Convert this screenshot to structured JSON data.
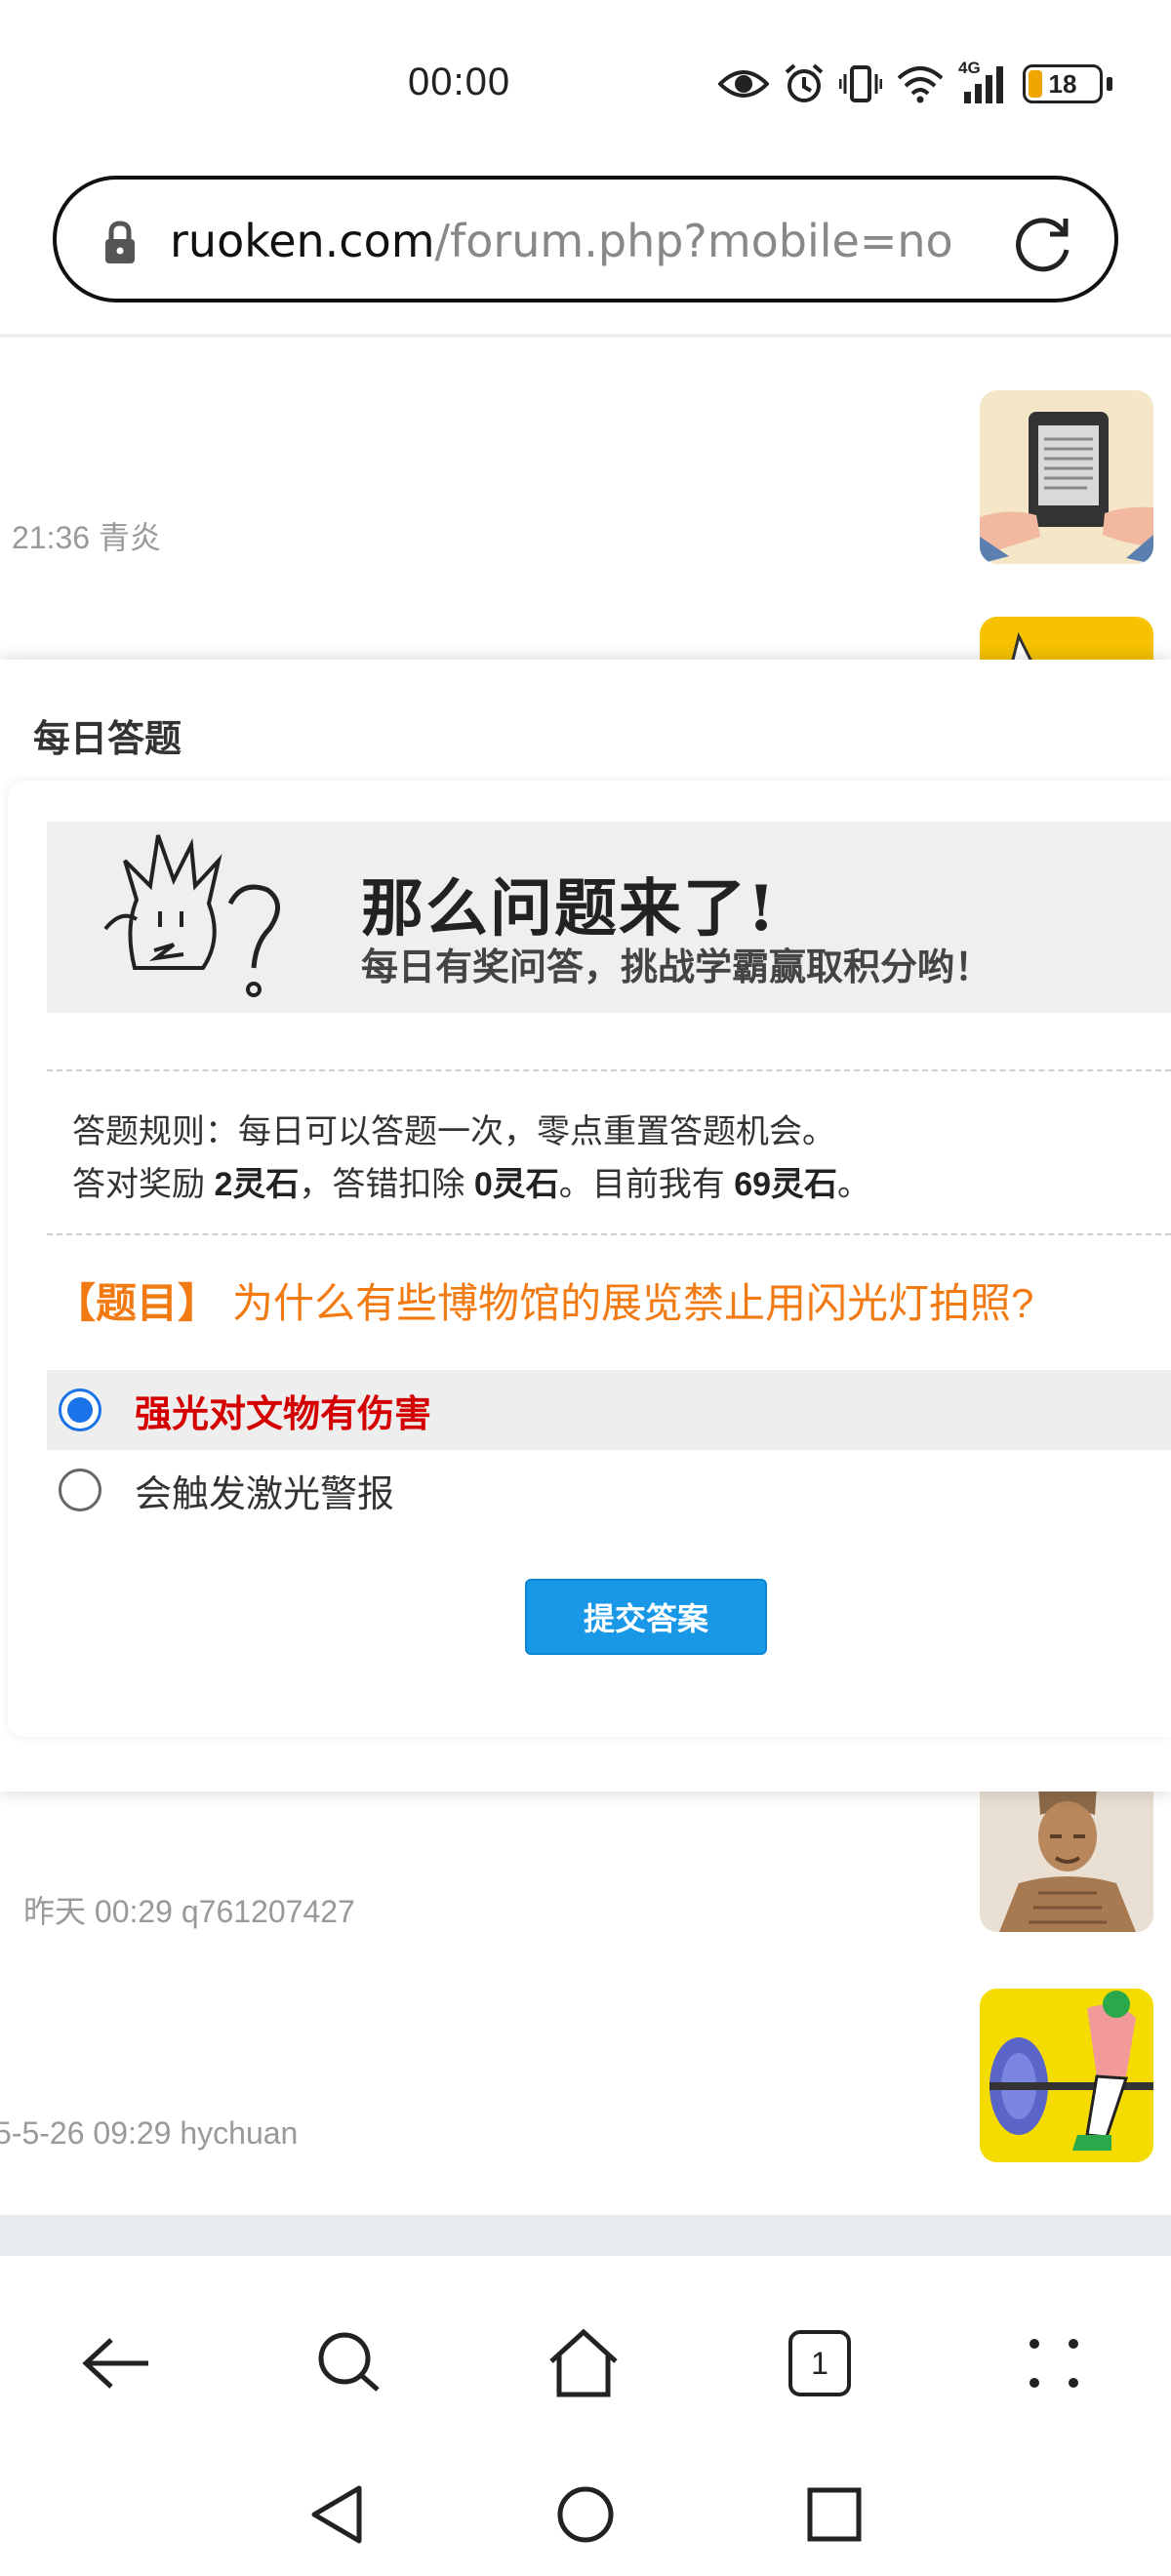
{
  "status_bar": {
    "time": "00:00",
    "network": "4G",
    "battery": "18",
    "icons": [
      "eye-icon",
      "alarm-icon",
      "vibrate-icon",
      "wifi-icon",
      "signal-icon",
      "battery-icon"
    ]
  },
  "url_bar": {
    "domain": "ruoken.com",
    "path": "/forum.php?mobile=no"
  },
  "forum_list": [
    {
      "meta": "21:36  青炎"
    },
    {
      "meta": "昨天 00:29  q761207427"
    },
    {
      "meta": "5-5-26 09:29  hychuan"
    }
  ],
  "modal": {
    "title": "每日答题",
    "banner_heading": "那么问题来了!",
    "banner_subtitle": "每日有奖问答，挑战学霸赢取积分哟！",
    "rules": {
      "line1": "答题规则：每日可以答题一次，零点重置答题机会。",
      "reward_prefix": "答对奖励 ",
      "reward_value": "2灵石",
      "penalty_prefix": "，答错扣除 ",
      "penalty_value": "0灵石",
      "current_prefix": "。目前我有 ",
      "current_value": "69灵石",
      "current_suffix": "。"
    },
    "question_tag": "【题目】",
    "question_text": "为什么有些博物馆的展览禁止用闪光灯拍照?",
    "options": [
      {
        "label": "强光对文物有伤害",
        "selected": true
      },
      {
        "label": "会触发激光警报",
        "selected": false
      }
    ],
    "submit_label": "提交答案"
  },
  "bottom_nav": {
    "tab_count": "1",
    "items": [
      "back-arrow-icon",
      "search-icon",
      "home-icon",
      "tabs-icon",
      "menu-dots-icon"
    ]
  },
  "colors": {
    "question_orange": "#f27a12",
    "selected_red": "#d40000",
    "button_blue": "#1a98e8",
    "radio_blue": "#1a73e8"
  }
}
